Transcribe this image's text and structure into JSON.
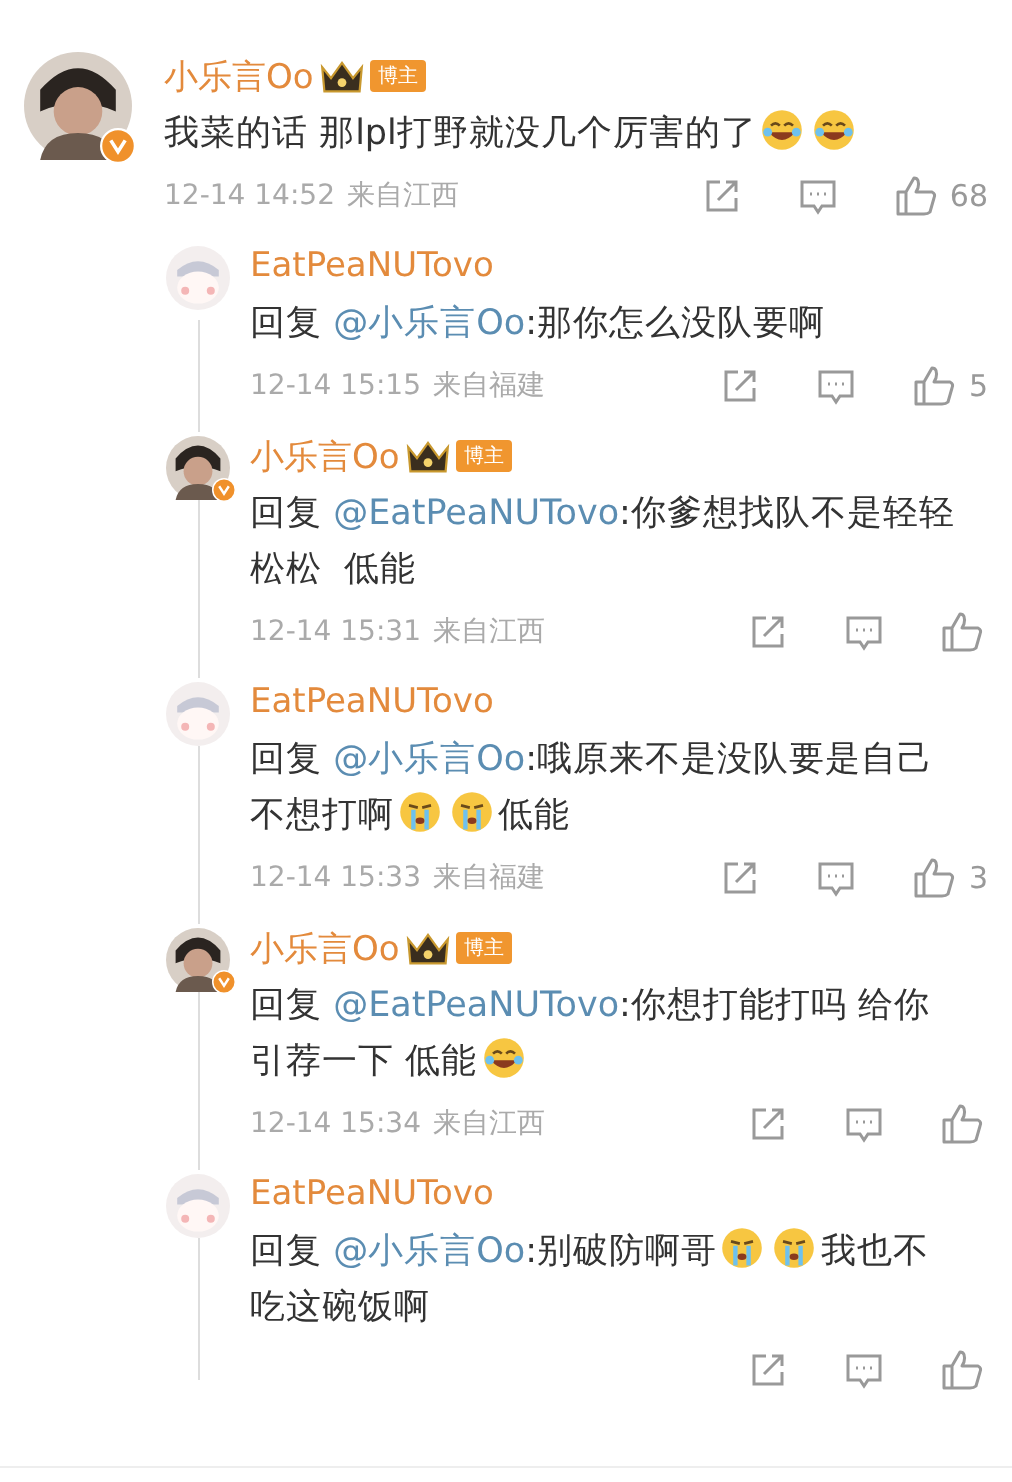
{
  "comment": {
    "author": "小乐言Oo",
    "blogger": true,
    "badge": "博主",
    "verified": true,
    "parts": [
      {
        "kind": "text",
        "text": "我菜的话 那lpl打野就没几个厉害的了"
      },
      {
        "kind": "laugh"
      },
      {
        "kind": "laugh"
      }
    ],
    "time": "12-14 14:52",
    "location": "来自江西",
    "likes": "68"
  },
  "replies": [
    {
      "author": "EatPeaNUTovo",
      "blogger": false,
      "verified": false,
      "parts": [
        {
          "kind": "text",
          "text": "回复 "
        },
        {
          "kind": "mention",
          "text": "@小乐言Oo"
        },
        {
          "kind": "text",
          "text": ":那你怎么没队要啊"
        }
      ],
      "time": "12-14 15:15",
      "location": "来自福建",
      "likes": "5"
    },
    {
      "author": "小乐言Oo",
      "blogger": true,
      "badge": "博主",
      "verified": true,
      "parts": [
        {
          "kind": "text",
          "text": "回复 "
        },
        {
          "kind": "mention",
          "text": "@EatPeaNUTovo"
        },
        {
          "kind": "text",
          "text": ":你爹想找队不是轻轻松松  低能"
        }
      ],
      "time": "12-14 15:31",
      "location": "来自江西"
    },
    {
      "author": "EatPeaNUTovo",
      "blogger": false,
      "verified": false,
      "parts": [
        {
          "kind": "text",
          "text": "回复 "
        },
        {
          "kind": "mention",
          "text": "@小乐言Oo"
        },
        {
          "kind": "text",
          "text": ":哦原来不是没队要是自己不想打啊"
        },
        {
          "kind": "cry"
        },
        {
          "kind": "cry"
        },
        {
          "kind": "text",
          "text": "低能"
        }
      ],
      "time": "12-14 15:33",
      "location": "来自福建",
      "likes": "3"
    },
    {
      "author": "小乐言Oo",
      "blogger": true,
      "badge": "博主",
      "verified": true,
      "parts": [
        {
          "kind": "text",
          "text": "回复 "
        },
        {
          "kind": "mention",
          "text": "@EatPeaNUTovo"
        },
        {
          "kind": "text",
          "text": ":你想打能打吗 给你引荐一下 低能"
        },
        {
          "kind": "laugh"
        }
      ],
      "time": "12-14 15:34",
      "location": "来自江西"
    },
    {
      "author": "EatPeaNUTovo",
      "blogger": false,
      "verified": false,
      "parts": [
        {
          "kind": "text",
          "text": "回复 "
        },
        {
          "kind": "mention",
          "text": "@小乐言Oo"
        },
        {
          "kind": "text",
          "text": ":别破防啊哥"
        },
        {
          "kind": "cry"
        },
        {
          "kind": "cry"
        },
        {
          "kind": "text",
          "text": "我也不吃这碗饭啊"
        }
      ]
    }
  ]
}
